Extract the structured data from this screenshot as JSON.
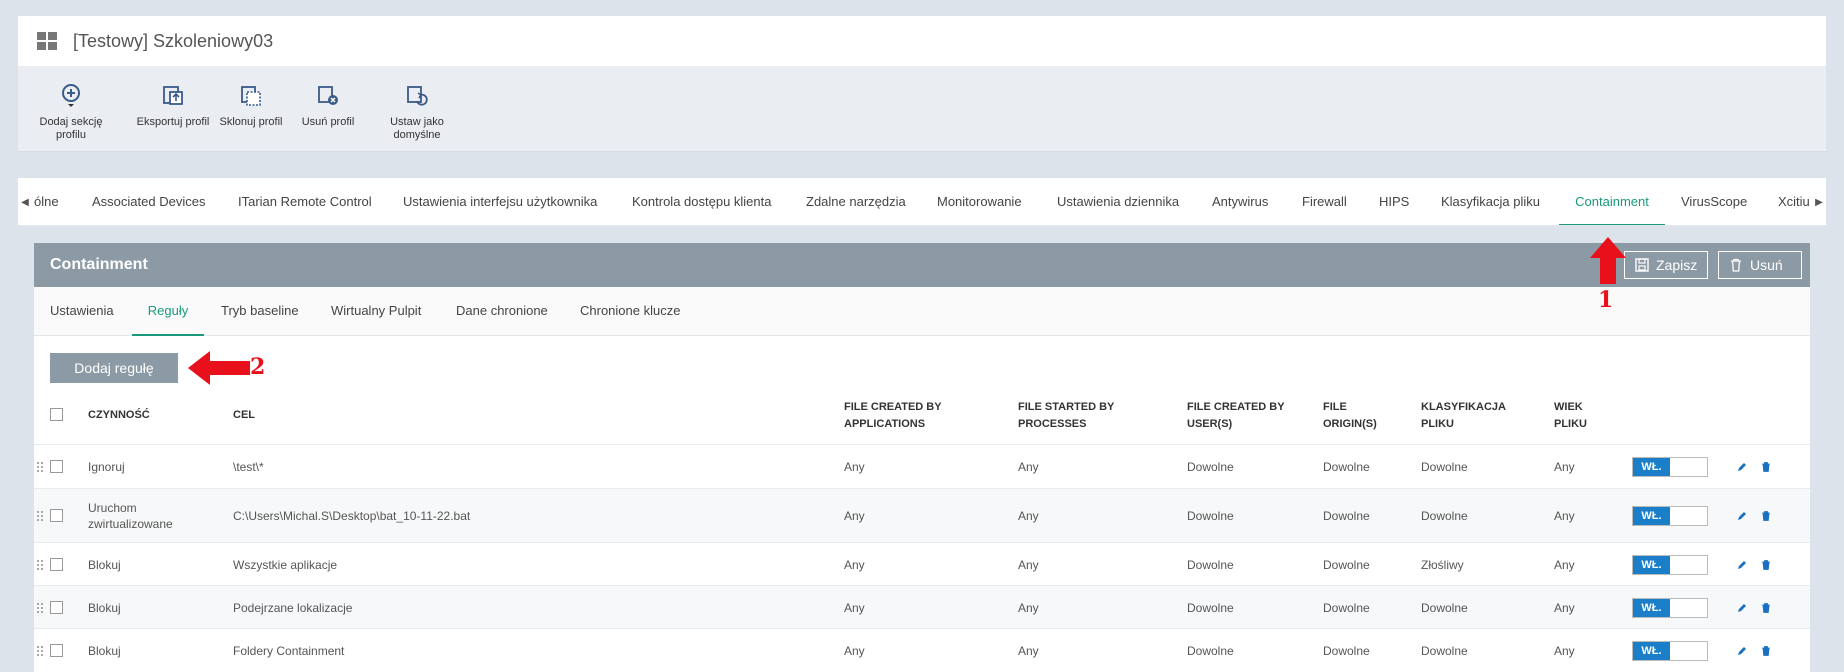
{
  "window": {
    "title": "[Testowy] Szkoleniowy03",
    "icon": "windows-icon"
  },
  "toolbar": {
    "buttons": [
      {
        "label": "Dodaj sekcję profilu",
        "icon": "add-section-icon"
      },
      {
        "label": "Eksportuj profil",
        "icon": "export-icon"
      },
      {
        "label": "Sklonuj profil",
        "icon": "clone-icon"
      },
      {
        "label": "Usuń profil",
        "icon": "delete-profile-icon"
      },
      {
        "label": "Ustaw jako domyślne",
        "icon": "set-default-icon"
      }
    ]
  },
  "tabs": {
    "items": [
      "ólne",
      "Associated Devices",
      "ITarian Remote Control",
      "Ustawienia interfejsu użytkownika",
      "Kontrola dostępu klienta",
      "Zdalne narzędzia",
      "Monitorowanie",
      "Ustawienia dziennika",
      "Antywirus",
      "Firewall",
      "HIPS",
      "Klasyfikacja pliku",
      "Containment",
      "VirusScope",
      "Xcitiu"
    ],
    "active": "Containment"
  },
  "panel": {
    "title": "Containment",
    "save_label": "Zapisz",
    "delete_label": "Usuń"
  },
  "subtabs": {
    "items": [
      "Ustawienia",
      "Reguły",
      "Tryb baseline",
      "Wirtualny Pulpit",
      "Dane chronione",
      "Chronione klucze"
    ],
    "active": "Reguły"
  },
  "add_rule_label": "Dodaj regułę",
  "table": {
    "headers": {
      "action": "CZYNNOŚĆ",
      "target": "CEL",
      "created_by_apps_1": "FILE CREATED BY",
      "created_by_apps_2": "APPLICATIONS",
      "started_by_1": "FILE STARTED BY",
      "started_by_2": "PROCESSES",
      "created_by_users_1": "FILE CREATED BY",
      "created_by_users_2": "USER(S)",
      "origin_1": "FILE",
      "origin_2": "ORIGIN(S)",
      "classification_1": "KLASYFIKACJA",
      "classification_2": "PLIKU",
      "age_1": "WIEK",
      "age_2": "PLIKU"
    },
    "rows": [
      {
        "action": "Ignoruj",
        "action2": "",
        "target": "\\test\\*",
        "apps": "Any",
        "processes": "Any",
        "users": "Dowolne",
        "origin": "Dowolne",
        "classification": "Dowolne",
        "age": "Any",
        "toggle": "WŁ."
      },
      {
        "action": "Uruchom",
        "action2": "zwirtualizowane",
        "target": "C:\\Users\\Michal.S\\Desktop\\bat_10-11-22.bat",
        "apps": "Any",
        "processes": "Any",
        "users": "Dowolne",
        "origin": "Dowolne",
        "classification": "Dowolne",
        "age": "Any",
        "toggle": "WŁ."
      },
      {
        "action": "Blokuj",
        "action2": "",
        "target": "Wszystkie aplikacje",
        "apps": "Any",
        "processes": "Any",
        "users": "Dowolne",
        "origin": "Dowolne",
        "classification": "Złośliwy",
        "age": "Any",
        "toggle": "WŁ."
      },
      {
        "action": "Blokuj",
        "action2": "",
        "target": "Podejrzane lokalizacje",
        "apps": "Any",
        "processes": "Any",
        "users": "Dowolne",
        "origin": "Dowolne",
        "classification": "Dowolne",
        "age": "Any",
        "toggle": "WŁ."
      },
      {
        "action": "Blokuj",
        "action2": "",
        "target": "Foldery Containment",
        "apps": "Any",
        "processes": "Any",
        "users": "Dowolne",
        "origin": "Dowolne",
        "classification": "Dowolne",
        "age": "Any",
        "toggle": "WŁ."
      }
    ]
  },
  "annotations": {
    "one": "1",
    "two": "2",
    "color": "#e8101a"
  }
}
